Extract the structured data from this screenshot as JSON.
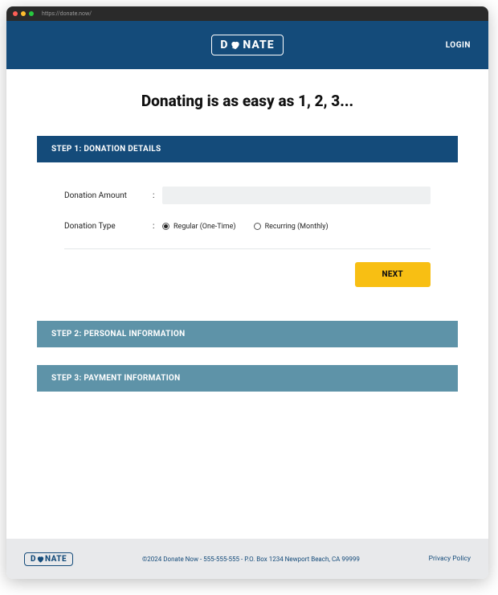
{
  "browser": {
    "url": "https://donate.now/"
  },
  "header": {
    "logo_left": "D",
    "logo_right": "NATE",
    "login": "LOGIN"
  },
  "page": {
    "title": "Donating is as easy as 1, 2, 3...",
    "step1": {
      "header": "STEP 1: DONATION DETAILS",
      "amount_label": "Donation Amount",
      "type_label": "Donation Type",
      "option_regular": "Regular (One-Time)",
      "option_recurring": "Recurring (Monthly)",
      "next": "NEXT"
    },
    "step2": {
      "header": "STEP 2: PERSONAL INFORMATION"
    },
    "step3": {
      "header": "STEP 3: PAYMENT INFORMATION"
    }
  },
  "footer": {
    "logo_left": "D",
    "logo_right": "NATE",
    "text": "©2024 Donate Now - 555-555-555 - P.O. Box 1234 Newport Beach, CA 99999",
    "privacy": "Privacy Policy"
  }
}
